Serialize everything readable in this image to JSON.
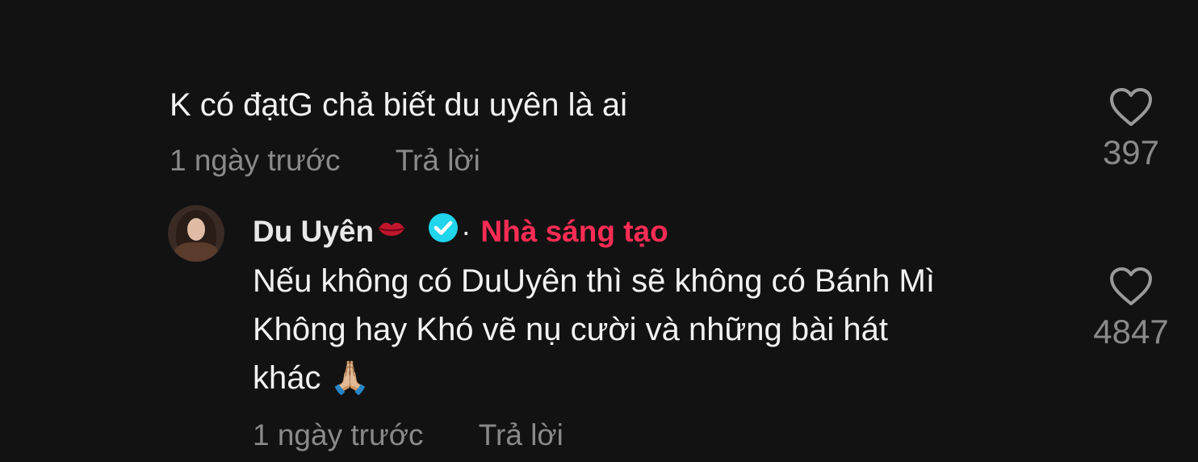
{
  "comment1": {
    "text": "K có đạtG chả biết du uyên là ai",
    "time": "1 ngày trước",
    "reply_label": "Trả lời",
    "likes": "397"
  },
  "comment2": {
    "author": "Du Uyên",
    "separator": "·",
    "creator_badge": "Nhà sáng tạo",
    "lines": [
      "Nếu không có DuUyên thì sẽ không có Bánh Mì",
      "Không hay Khó vẽ nụ cười và những bài hát",
      "khác 🙏🏼"
    ],
    "time": "1 ngày trước",
    "reply_label": "Trả lời",
    "likes": "4847"
  },
  "icons": {
    "like": "heart-outline-icon",
    "verified": "verified-check-icon",
    "lips": "kiss-mark-icon"
  },
  "colors": {
    "background": "#121212",
    "creator_badge": "#fe2c55",
    "verified": "#20d5ec",
    "muted": "#8a8a8a"
  }
}
